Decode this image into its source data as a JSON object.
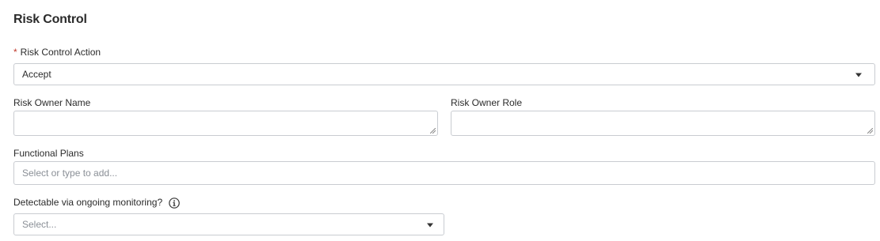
{
  "section": {
    "title": "Risk Control"
  },
  "risk_control_action": {
    "required_mark": "*",
    "label": "Risk Control Action",
    "value": "Accept"
  },
  "risk_owner_name": {
    "label": "Risk Owner Name",
    "value": ""
  },
  "risk_owner_role": {
    "label": "Risk Owner Role",
    "value": ""
  },
  "functional_plans": {
    "label": "Functional Plans",
    "placeholder": "Select or type to add..."
  },
  "detectable": {
    "label": "Detectable via ongoing monitoring?",
    "placeholder": "Select...",
    "info_icon": "info-icon"
  }
}
